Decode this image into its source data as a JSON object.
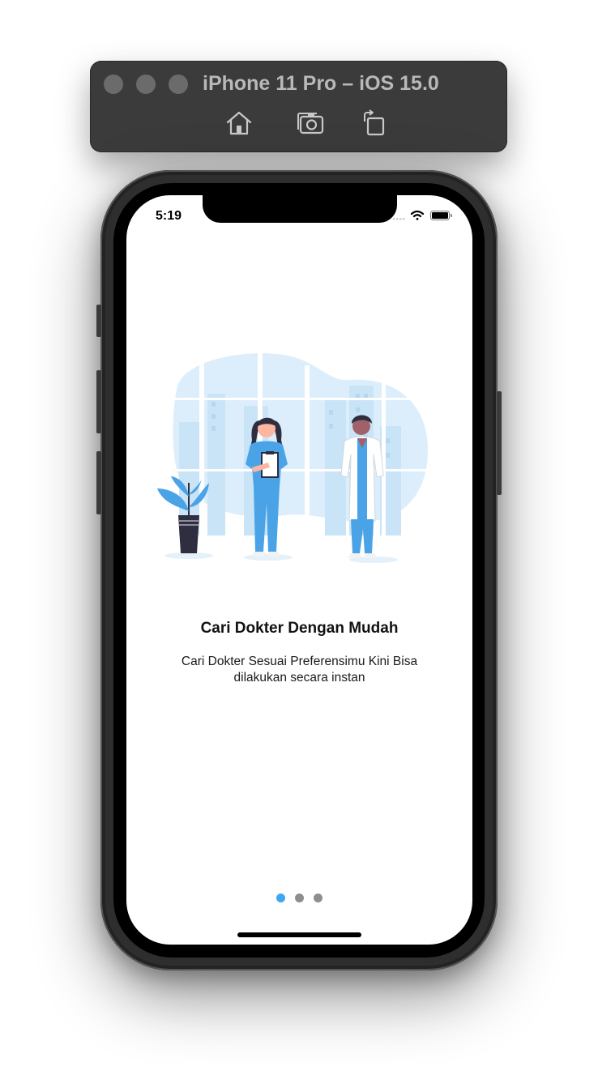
{
  "window": {
    "title": "iPhone 11 Pro – iOS 15.0",
    "toolbar": [
      "home-icon",
      "screenshot-icon",
      "rotate-icon"
    ]
  },
  "status_bar": {
    "time": "5:19",
    "icons": [
      "signal-icon",
      "wifi-icon",
      "battery-icon"
    ]
  },
  "onboarding": {
    "illustration": "doctors-illustration",
    "title": "Cari Dokter Dengan Mudah",
    "subtitle": "Cari Dokter Sesuai Preferensimu Kini Bisa dilakukan secara instan",
    "page_indicator": {
      "total": 3,
      "current": 1
    }
  },
  "colors": {
    "accent": "#3fa6f1",
    "scrub_blue": "#4aa3e6",
    "illustration_bg": "#dceefb",
    "dot_inactive": "#8e8e8e",
    "titlebar": "#3b3b3b"
  }
}
